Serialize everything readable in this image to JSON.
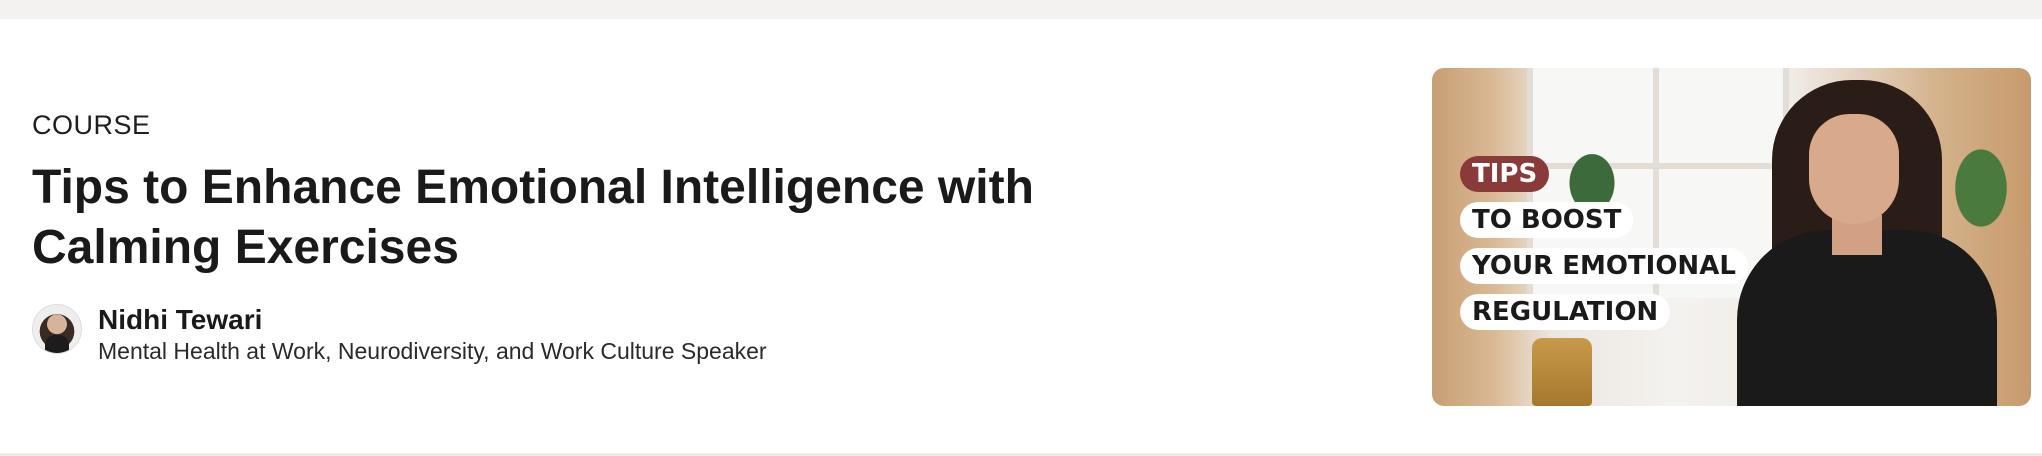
{
  "course": {
    "eyebrow": "COURSE",
    "title": "Tips to Enhance Emotional Intelligence with Calming Exercises",
    "author": {
      "name": "Nidhi Tewari",
      "role": "Mental Health at Work, Neurodiversity, and Work Culture Speaker"
    },
    "thumbnail": {
      "overlay_lines": [
        "TIPS",
        "TO BOOST",
        "YOUR EMOTIONAL",
        "REGULATION"
      ],
      "accent_color": "#8b3a3a"
    }
  },
  "colors": {
    "top_strip": "#f3f2f0",
    "background": "#ffffff",
    "text": "#1a1a1a"
  }
}
